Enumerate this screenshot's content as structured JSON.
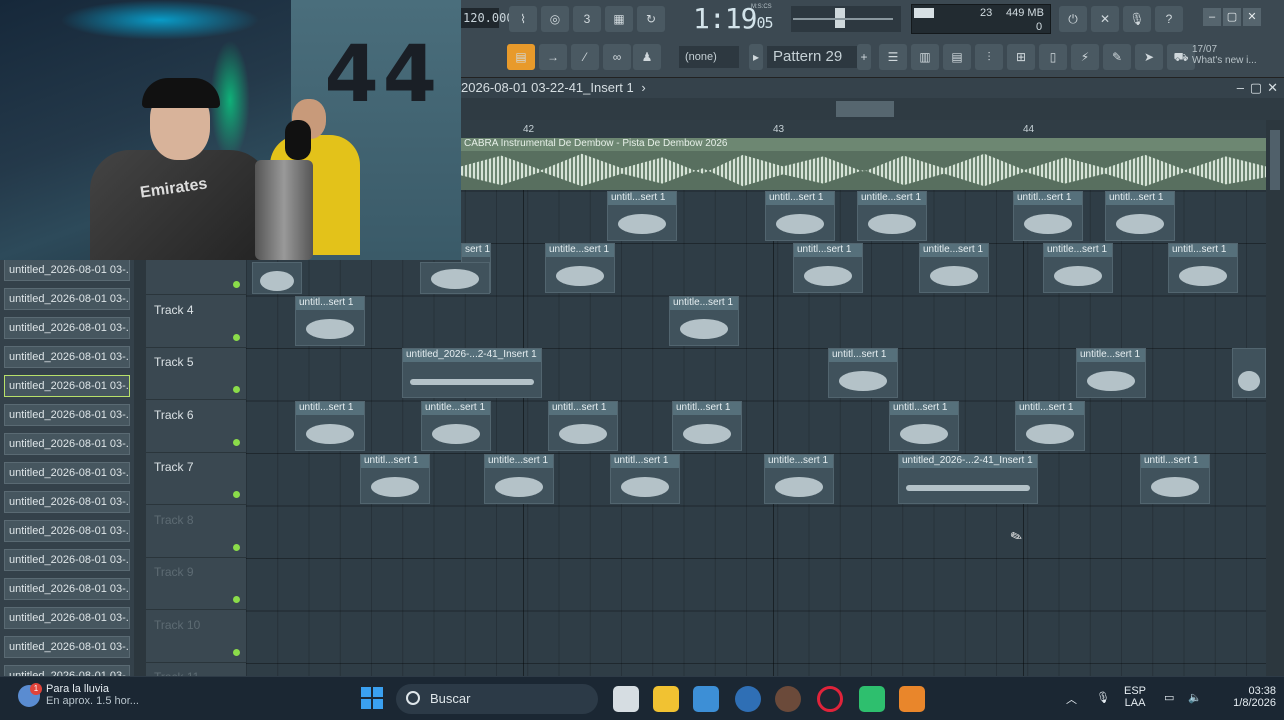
{
  "toolbar": {
    "tempo": "120.000",
    "time_main": "1:19",
    "time_frac": "05",
    "time_label": "M:S:CS",
    "cpu_value": "23",
    "memory_text": "449 MB",
    "poly_value": "0",
    "pattern_label": "Pattern 29",
    "none_select": "(none)",
    "news_date": "17/07",
    "news_text": "What's new i..."
  },
  "playlist": {
    "title": "2026-08-01 03-22-41_Insert 1",
    "ruler_marks": [
      "42",
      "43",
      "44"
    ],
    "master_label": "CABRA Instrumental De Dembow - Pista De Dembow 2026"
  },
  "browser": {
    "items": [
      "untitled_2026-08-01 03-...",
      "untitled_2026-08-01 03-...",
      "untitled_2026-08-01 03-...",
      "untitled_2026-08-01 03-...",
      "untitled_2026-08-01 03-...",
      "untitled_2026-08-01 03-...",
      "untitled_2026-08-01 03-...",
      "untitled_2026-08-01 03-...",
      "untitled_2026-08-01 03-...",
      "untitled_2026-08-01 03-...",
      "untitled_2026-08-01 03-...",
      "untitled_2026-08-01 03-...",
      "untitled_2026-08-01 03-...",
      "untitled_2026-08-01 03-...",
      "untitled_2026-08-01 03-..."
    ],
    "selected_index": 4
  },
  "tracks": [
    {
      "name": "",
      "dim": false
    },
    {
      "name": "Track 4",
      "dim": false
    },
    {
      "name": "Track 5",
      "dim": false
    },
    {
      "name": "Track 6",
      "dim": false
    },
    {
      "name": "Track 7",
      "dim": false
    },
    {
      "name": "Track 8",
      "dim": true
    },
    {
      "name": "Track 9",
      "dim": true
    },
    {
      "name": "Track 10",
      "dim": true
    },
    {
      "name": "Track 11",
      "dim": true
    }
  ],
  "clip_labels": {
    "short": "untitl...sert 1",
    "short2": "untitle...sert 1",
    "long": "untitled_2026-...2-41_Insert 1",
    "long2": "untitled_2026-...2-41_Insert 1",
    "tail": "sert 1"
  },
  "webcam": {
    "wall_number": "44",
    "jersey_text": "Emirates"
  },
  "taskbar": {
    "weather_title": "Para la lluvia",
    "weather_sub": "En aprox. 1.5 hor...",
    "weather_badge": "1",
    "search_placeholder": "Buscar",
    "lang": "ESP",
    "lang_sub": "LAA",
    "clock_time": "03:38",
    "clock_date": "1/8/2026"
  },
  "colors": {
    "accent_green": "#8bdc4a",
    "clip_bg": "#40525c",
    "master_bg": "#586f5f"
  }
}
